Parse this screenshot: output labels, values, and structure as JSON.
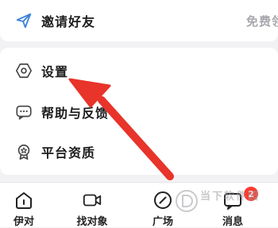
{
  "invite": {
    "label": "邀请好友",
    "aside": "免费领"
  },
  "menu": {
    "items": [
      {
        "label": "设置"
      },
      {
        "label": "帮助与反馈"
      },
      {
        "label": "平台资质"
      }
    ]
  },
  "tabbar": {
    "tabs": [
      {
        "label": "伊对"
      },
      {
        "label": "找对象"
      },
      {
        "label": "广场"
      },
      {
        "label": "消息",
        "badge": "2"
      }
    ]
  },
  "watermark": {
    "text": "当下软件园",
    "icon": "d-logo-watermark"
  },
  "colors": {
    "arrow": "#e8342a",
    "badge": "#ff3b30",
    "accent_icon": "#4a90e2"
  }
}
